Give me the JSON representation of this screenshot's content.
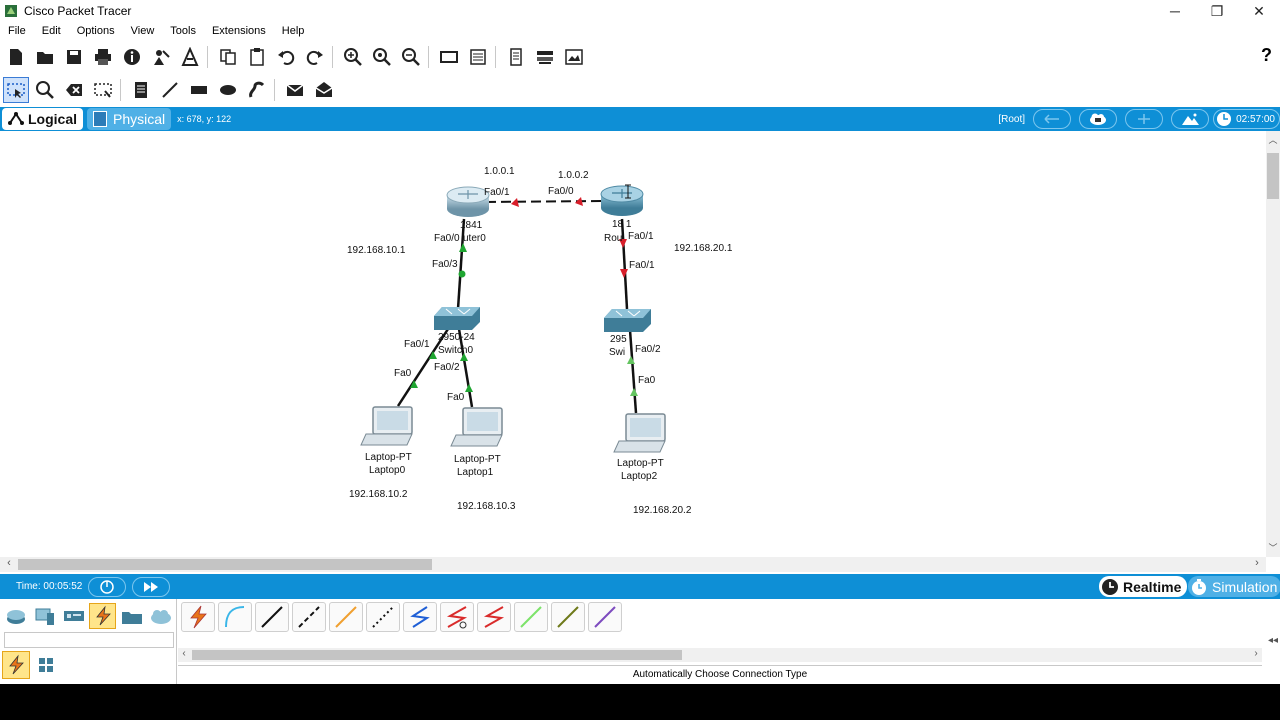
{
  "window": {
    "title": "Cisco Packet Tracer",
    "controls": [
      "─",
      "❐",
      "✕"
    ]
  },
  "menu": [
    "File",
    "Edit",
    "Options",
    "View",
    "Tools",
    "Extensions",
    "Help"
  ],
  "toolbar1": {
    "icons": [
      "new-icon",
      "open-icon",
      "save-icon",
      "print-icon",
      "info-icon",
      "wizard-icon",
      "network-info-icon",
      "copy-icon",
      "paste-icon",
      "undo-icon",
      "redo-icon",
      "zoom-in-icon",
      "zoom-reset-icon",
      "zoom-out-icon",
      "drawing-palette-icon",
      "custom-devices-icon",
      "viewport-icon",
      "cluster-icon",
      "cert-icon"
    ],
    "help": "?"
  },
  "toolbar2": {
    "icons": [
      "select-icon",
      "inspect-icon",
      "delete-icon",
      "resize-icon",
      "note-icon",
      "line-icon",
      "rectangle-icon",
      "ellipse-icon",
      "freeform-icon",
      "simple-pdu-icon",
      "complex-pdu-icon"
    ]
  },
  "logical_bar": {
    "logical_label": "Logical",
    "physical_label": "Physical",
    "coords": "x: 678, y: 122",
    "root_label": "[Root]",
    "clock": "02:57:00"
  },
  "topology": {
    "routers": [
      {
        "id": "router0",
        "model": "1841",
        "name": "Router0"
      },
      {
        "id": "router1",
        "model": "1841",
        "name": "Router1"
      }
    ],
    "switches": [
      {
        "id": "switch0",
        "model": "2950-24",
        "name": "Switch0"
      },
      {
        "id": "switch1",
        "model": "2950-24",
        "name": "Switch1"
      }
    ],
    "laptops": [
      {
        "id": "laptop0",
        "model": "Laptop-PT",
        "name": "Laptop0",
        "ip": "192.168.10.2"
      },
      {
        "id": "laptop1",
        "model": "Laptop-PT",
        "name": "Laptop1",
        "ip": "192.168.10.3"
      },
      {
        "id": "laptop2",
        "model": "Laptop-PT",
        "name": "Laptop2",
        "ip": "192.168.20.2"
      }
    ],
    "ip_labels": {
      "r0_wan": "1.0.0.1",
      "r1_wan": "1.0.0.2",
      "r0_lan": "192.168.10.1",
      "r1_lan": "192.168.20.1"
    },
    "port_labels": {
      "r0_wan": "Fa0/1",
      "r1_wan": "Fa0/0",
      "r0_lan": "Fa0/0",
      "sw0_up": "Fa0/3",
      "r1_lan": "Fa0/1",
      "sw1_up": "Fa0/1",
      "sw0_p1": "Fa0/1",
      "sw0_p2": "Fa0/2",
      "sw1_p2": "Fa0/2",
      "l0": "Fa0",
      "l1": "Fa0",
      "l2": "Fa0"
    },
    "partial_labels": {
      "r0_name": "uter0",
      "r1_name": "Rou",
      "r1_model": "18 1",
      "sw1_model": "295",
      "sw1_name": "Swi"
    }
  },
  "timebar": {
    "time": "Time: 00:05:52",
    "realtime": "Realtime",
    "simulation": "Simulation"
  },
  "bottom": {
    "categories": [
      "network-devices-icon",
      "end-devices-icon",
      "components-icon",
      "connections-icon",
      "misc-icon",
      "multiuser-icon"
    ],
    "subcategories": [
      "connections-icon",
      "grid-icon"
    ],
    "connections": [
      {
        "icon": "auto-connection-icon",
        "color": "#e8741a"
      },
      {
        "icon": "console-cable-icon",
        "color": "#3ab6e8"
      },
      {
        "icon": "copper-straight-icon",
        "color": "#111111"
      },
      {
        "icon": "copper-cross-icon",
        "color": "#111111"
      },
      {
        "icon": "fiber-icon",
        "color": "#f0a030"
      },
      {
        "icon": "phone-cable-icon",
        "color": "#111111"
      },
      {
        "icon": "coaxial-icon",
        "color": "#1f5fd6"
      },
      {
        "icon": "serial-dce-icon",
        "color": "#d92b2b"
      },
      {
        "icon": "serial-dte-icon",
        "color": "#d92b2b"
      },
      {
        "icon": "octal-icon",
        "color": "#7de36a"
      },
      {
        "icon": "iot-custom-icon",
        "color": "#6f7a1a"
      },
      {
        "icon": "usb-icon",
        "color": "#7e4bbf"
      }
    ],
    "connection_label": "Automatically Choose Connection Type"
  }
}
